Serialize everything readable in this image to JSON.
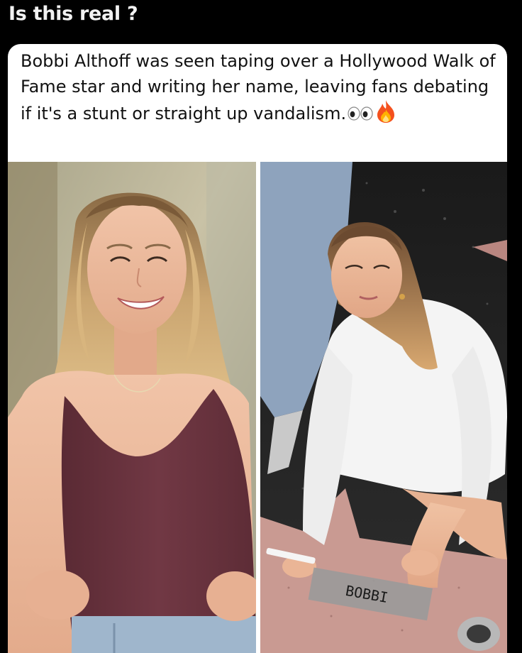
{
  "header": {
    "title": "Is this real ?"
  },
  "post": {
    "caption": "Bobbi Althoff was seen taping over a Hollywood Walk of Fame star and writing her name, leaving fans debating if it's a stunt or straight up vandalism.",
    "emojis": [
      "eyes-emoji",
      "fire-emoji"
    ]
  },
  "photos": {
    "left": {
      "icon": "portrait-photo"
    },
    "right": {
      "icon": "walk-of-fame-photo",
      "tape_text": "BOBBI"
    }
  },
  "colors": {
    "background": "#000000",
    "card": "#ffffff",
    "top_color": "#6e3440",
    "star_pink": "#c99a92"
  }
}
